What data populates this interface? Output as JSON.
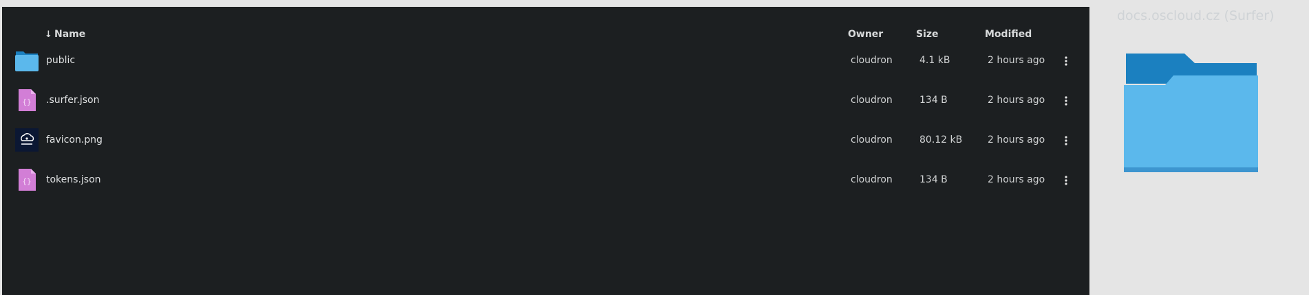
{
  "file_list": {
    "columns": {
      "name": "Name",
      "owner": "Owner",
      "size": "Size",
      "modified": "Modified"
    },
    "sort_indicator": "↓",
    "rows": [
      {
        "name": "public",
        "icon": "folder-icon",
        "owner": "cloudron",
        "size": "4.1 kB",
        "modified": "2 hours ago"
      },
      {
        "name": ".surfer.json",
        "icon": "json-file-icon",
        "owner": "cloudron",
        "size": "134 B",
        "modified": "2 hours ago"
      },
      {
        "name": "favicon.png",
        "icon": "image-file-icon",
        "owner": "cloudron",
        "size": "80.12 kB",
        "modified": "2 hours ago"
      },
      {
        "name": "tokens.json",
        "icon": "json-file-icon",
        "owner": "cloudron",
        "size": "134 B",
        "modified": "2 hours ago"
      }
    ]
  },
  "preview": {
    "title": "docs.oscloud.cz (Surfer)",
    "icon": "folder-icon"
  },
  "colors": {
    "pane_bg": "#1c1f21",
    "side_bg": "#e5e5e5",
    "folder_light": "#5bb8ec",
    "folder_dark": "#1b80c0",
    "json_file": "#d27ed6"
  }
}
